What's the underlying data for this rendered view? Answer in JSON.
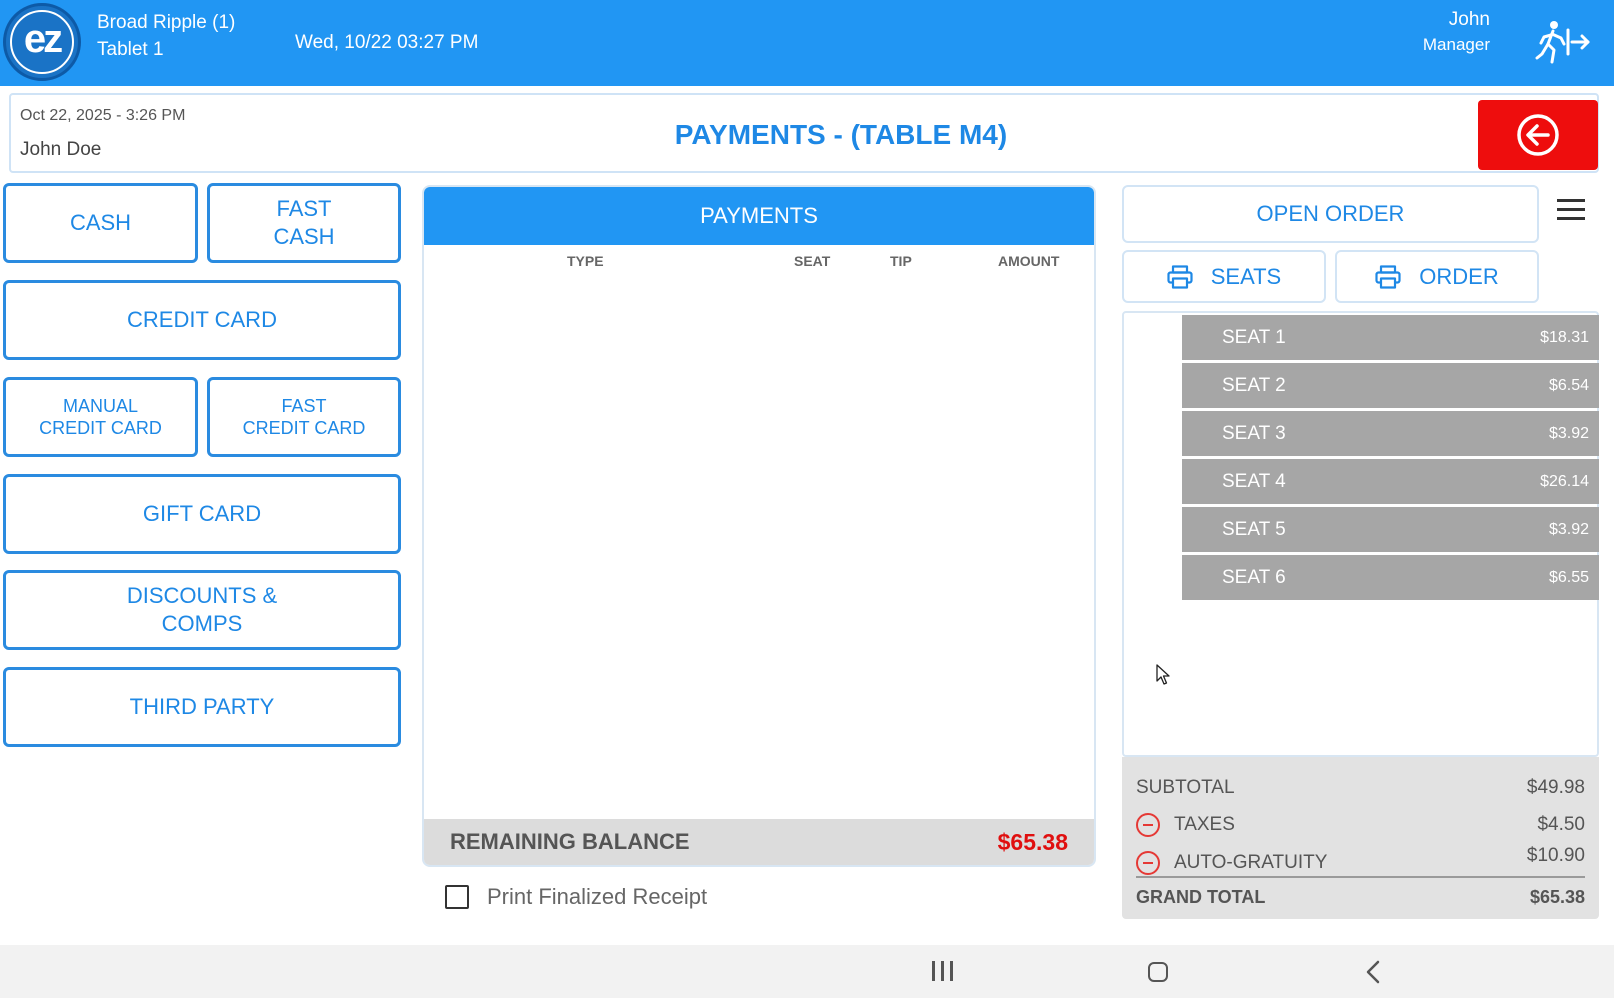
{
  "topbar": {
    "logo_text": "ez",
    "store_name": "Broad Ripple (1)",
    "tablet_name": "Tablet 1",
    "datetime": "Wed, 10/22 03:27 PM",
    "user_name": "John",
    "user_role": "Manager",
    "logout_icon": "logout-running-person-icon"
  },
  "header": {
    "order_date": "Oct 22, 2025  - 3:26 PM",
    "customer": "John Doe",
    "title": "PAYMENTS - (TABLE M4)",
    "back_icon": "arrow-left-circle-icon"
  },
  "payment_methods": {
    "cash": "CASH",
    "fast_cash": "FAST\nCASH",
    "credit_card": "CREDIT CARD",
    "manual_credit_card": "MANUAL\nCREDIT CARD",
    "fast_credit_card": "FAST\nCREDIT CARD",
    "gift_card": "GIFT CARD",
    "discounts_comps": "DISCOUNTS &\nCOMPS",
    "third_party": "THIRD PARTY"
  },
  "payments": {
    "header": "PAYMENTS",
    "columns": [
      "TYPE",
      "SEAT",
      "TIP",
      "AMOUNT"
    ],
    "rows": [],
    "remaining_label": "REMAINING BALANCE",
    "remaining_value": "$65.38",
    "print_receipt_label": "Print Finalized Receipt",
    "print_receipt_checked": false
  },
  "right_panel": {
    "open_order": "OPEN ORDER",
    "menu_icon": "hamburger-menu-icon",
    "print_seats": "SEATS",
    "print_order": "ORDER",
    "print_icon": "printer-icon",
    "seats": [
      {
        "label": "SEAT 1",
        "amount": "$18.31"
      },
      {
        "label": "SEAT 2",
        "amount": "$6.54"
      },
      {
        "label": "SEAT 3",
        "amount": "$3.92"
      },
      {
        "label": "SEAT 4",
        "amount": "$26.14"
      },
      {
        "label": "SEAT 5",
        "amount": "$3.92"
      },
      {
        "label": "SEAT 6",
        "amount": "$6.55"
      }
    ]
  },
  "totals": {
    "subtotal_label": "SUBTOTAL",
    "subtotal_value": "$49.98",
    "taxes_label": "TAXES",
    "taxes_value": "$4.50",
    "gratuity_label": "AUTO-GRATUITY",
    "gratuity_value": "$10.90",
    "grand_total_label": "GRAND TOTAL",
    "grand_total_value": "$65.38"
  },
  "colors": {
    "primary_blue": "#2196f3",
    "back_red": "#ee0d0d",
    "balance_red": "#e00f0f",
    "seat_gray": "#a6a6a6"
  }
}
